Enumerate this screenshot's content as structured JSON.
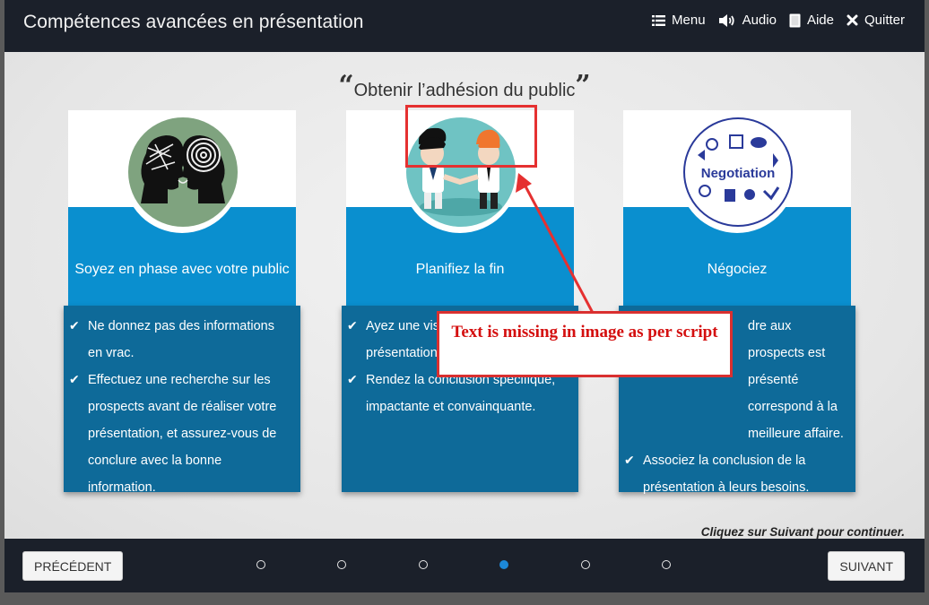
{
  "app": {
    "title": "Compétences avancées en présentation"
  },
  "nav": [
    {
      "icon": "menu-icon",
      "label": "Menu"
    },
    {
      "icon": "audio-icon",
      "label": "Audio"
    },
    {
      "icon": "help-icon",
      "label": "Aide"
    },
    {
      "icon": "close-icon",
      "label": "Quitter"
    }
  ],
  "slide": {
    "heading": "Obtenir l’adhésion du public",
    "cards": [
      {
        "image": "two-heads-illustration",
        "title": "Soyez en phase avec votre public",
        "bullets": [
          "Ne donnez pas des informations en vrac.",
          "Effectuez une recherche sur les prospects avant de réaliser votre présentation, et assurez-vous de conclure avec la bonne information."
        ]
      },
      {
        "image": "handshake-illustration",
        "title": "Planifiez la fin",
        "bullets": [
          "Ayez une vis attendez du présentation.",
          "Rendez la conclusion spécifique, impactante et convainquante."
        ]
      },
      {
        "image": "negotiation-illustration",
        "title": "Négociez",
        "image_text": "Negotiation",
        "bullets": [
          "dre aux prospects est présenté correspond à la meilleure affaire.",
          "Associez la conclusion de la présentation à leurs besoins."
        ]
      }
    ],
    "hint": "Cliquez sur Suivant pour continuer."
  },
  "footer": {
    "prev_label": "PRÉCÉDENT",
    "next_label": "SUIVANT",
    "dots": 6,
    "active_dot": 4
  },
  "annotation": {
    "text": "Text is missing in image as per script",
    "color": "#e53030"
  },
  "colors": {
    "topbar": "#1b202a",
    "card_band": "#0a8fcf",
    "card_body": "#0e6a99",
    "active_dot": "#1c88d8"
  }
}
